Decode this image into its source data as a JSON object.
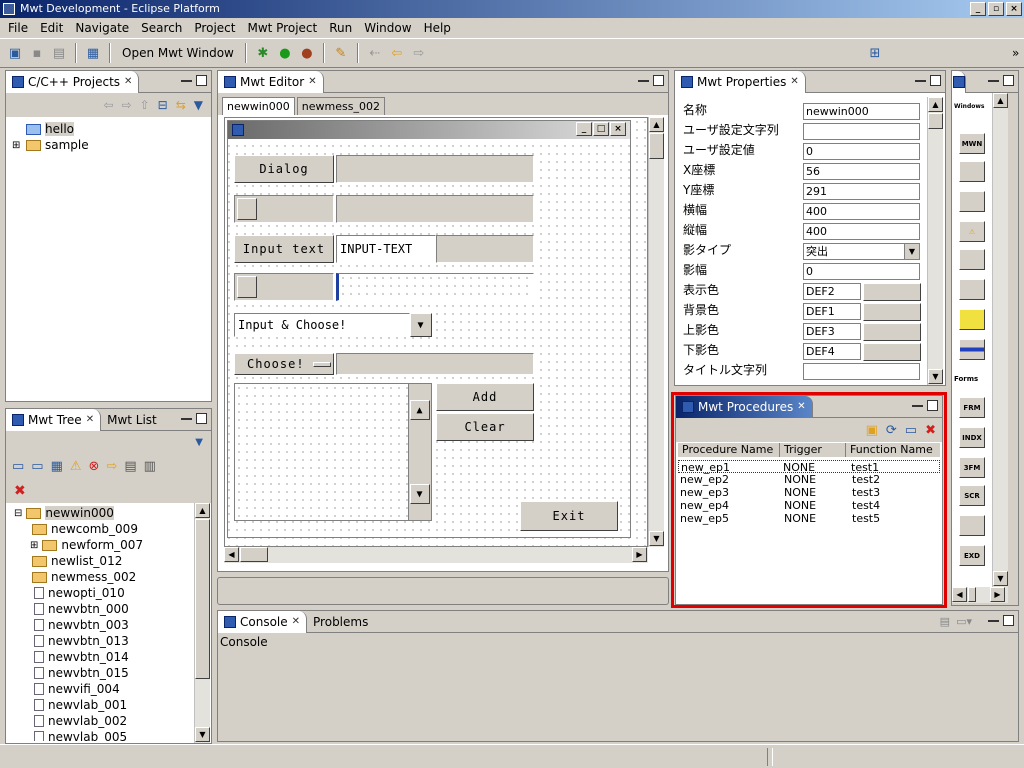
{
  "window": {
    "title": "Mwt Development - Eclipse Platform"
  },
  "menu": [
    "File",
    "Edit",
    "Navigate",
    "Search",
    "Project",
    "Mwt Project",
    "Run",
    "Window",
    "Help"
  ],
  "toolbar": {
    "open_mwt_window": "Open Mwt Window"
  },
  "projects_view": {
    "tab": "C/C++ Projects",
    "items": [
      "hello",
      "sample"
    ]
  },
  "tree_view": {
    "tab_tree": "Mwt Tree",
    "tab_list": "Mwt List",
    "root": "newwin000",
    "items": [
      "newcomb_009",
      "newform_007",
      "newlist_012",
      "newmess_002",
      "newopti_010",
      "newvbtn_000",
      "newvbtn_003",
      "newvbtn_013",
      "newvbtn_014",
      "newvbtn_015",
      "newvifi_004",
      "newvlab_001",
      "newvlab_002",
      "newvlab_005"
    ]
  },
  "editor": {
    "tab": "Mwt Editor",
    "subtabs": [
      "newwin000",
      "newmess_002"
    ],
    "form": {
      "dialog_btn": "Dialog",
      "input_btn": "Input text",
      "input_value": "INPUT-TEXT",
      "combo_value": "Input & Choose!",
      "choose_btn": "Choose!",
      "add_btn": "Add",
      "clear_btn": "Clear",
      "exit_btn": "Exit"
    }
  },
  "properties": {
    "tab": "Mwt Properties",
    "rows": [
      {
        "name": "名称",
        "value": "newwin000"
      },
      {
        "name": "ユーザ設定文字列",
        "value": ""
      },
      {
        "name": "ユーザ設定値",
        "value": "0"
      },
      {
        "name": "X座標",
        "value": "56"
      },
      {
        "name": "Y座標",
        "value": "291"
      },
      {
        "name": "横幅",
        "value": "400"
      },
      {
        "name": "縦幅",
        "value": "400"
      },
      {
        "name": "影タイプ",
        "value": "突出"
      },
      {
        "name": "影幅",
        "value": "0"
      },
      {
        "name": "表示色",
        "value": "DEF2"
      },
      {
        "name": "背景色",
        "value": "DEF1"
      },
      {
        "name": "上影色",
        "value": "DEF3"
      },
      {
        "name": "下影色",
        "value": "DEF4"
      },
      {
        "name": "タイトル文字列",
        "value": ""
      }
    ]
  },
  "procedures": {
    "tab": "Mwt Procedures",
    "columns": [
      "Procedure Name",
      "Trigger",
      "Function Name"
    ],
    "rows": [
      [
        "new_ep1",
        "NONE",
        "test1"
      ],
      [
        "new_ep2",
        "NONE",
        "test2"
      ],
      [
        "new_ep3",
        "NONE",
        "test3"
      ],
      [
        "new_ep4",
        "NONE",
        "test4"
      ],
      [
        "new_ep5",
        "NONE",
        "test5"
      ]
    ]
  },
  "palette": {
    "header": "Windows",
    "forms_header": "Forms",
    "items": [
      "MWN",
      "",
      "",
      "⚠",
      "",
      "",
      "",
      "",
      "FRM",
      "INDX",
      "3FM",
      "SCR",
      "",
      "EXD"
    ]
  },
  "console": {
    "tab_console": "Console",
    "tab_problems": "Problems",
    "label": "Console"
  },
  "colors": {
    "highlight_border": "#e00000",
    "title_start": "#0a246a",
    "title_end": "#a6caf0"
  }
}
